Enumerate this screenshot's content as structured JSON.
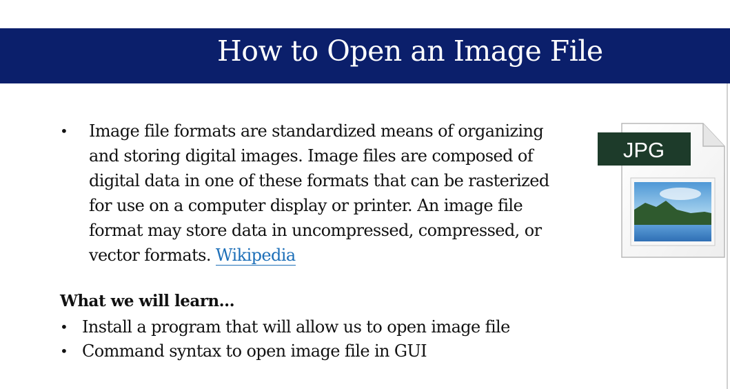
{
  "slide": {
    "title": "How to Open an Image File",
    "paragraph_lines": [
      "Image file formats are standardized means of organizing",
      "and storing digital images. Image files are composed of",
      "digital data in one of these formats that can be rasterized",
      "for use on a computer display or printer. An image file",
      "format may store data in uncompressed, compressed, or"
    ],
    "paragraph_last_line": "vector formats.",
    "link_text": "Wikipedia",
    "learn_heading": "What we will learn…",
    "learn_items": [
      "Install a program that will allow us to open image file",
      "Command syntax to open image file in GUI"
    ],
    "bullet_glyph": "•"
  },
  "icon": {
    "name": "jpg-file-icon",
    "label": "JPG",
    "label_bg": "#1d3b2a"
  },
  "colors": {
    "title_bar": "#0b1f6b",
    "link": "#1d6fb8"
  }
}
